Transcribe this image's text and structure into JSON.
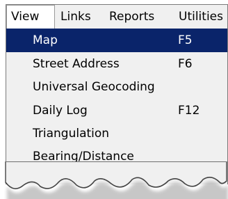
{
  "menubar": {
    "items": [
      {
        "label": "View"
      },
      {
        "label": "Links"
      },
      {
        "label": "Reports"
      },
      {
        "label": "Utilities"
      }
    ]
  },
  "view_menu": {
    "items": [
      {
        "label": "Map",
        "shortcut": "F5",
        "selected": true
      },
      {
        "label": "Street Address",
        "shortcut": "F6"
      },
      {
        "label": "Universal Geocoding",
        "shortcut": ""
      },
      {
        "label": "Daily Log",
        "shortcut": "F12"
      },
      {
        "label": "Triangulation",
        "shortcut": ""
      },
      {
        "label": "Bearing/Distance",
        "shortcut": ""
      }
    ]
  },
  "colors": {
    "highlight": "#0a246a",
    "menu_background": "#f0f0f0"
  }
}
